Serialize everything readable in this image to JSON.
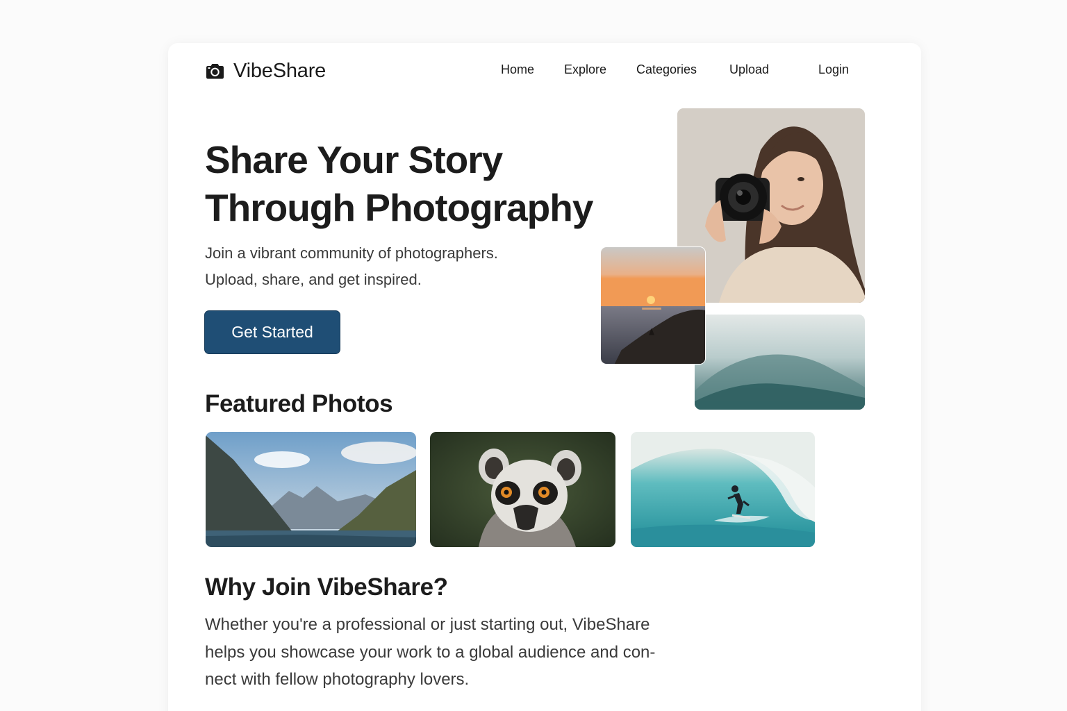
{
  "brand": {
    "name": "VibeShare",
    "icon": "camera-icon"
  },
  "nav": {
    "home": "Home",
    "explore": "Explore",
    "categories": "Categories",
    "upload": "Upload",
    "login": "Login"
  },
  "hero": {
    "title_line1": "Share Your Story",
    "title_line2": "Through Photography",
    "subtitle_line1": "Join a vibrant community of photographers.",
    "subtitle_line2": "Upload, share, and get inspired.",
    "cta_label": "Get Started"
  },
  "featured": {
    "heading": "Featured Photos"
  },
  "why": {
    "heading": "Why Join VibeShare?",
    "line1": "Whether you're a professional or just starting out, VibeShare",
    "line2": "helps you showcase your work to a global audience and con-",
    "line3": "nect with fellow photography lovers."
  },
  "colors": {
    "accent": "#1f4e75",
    "text": "#1c1c1c",
    "muted": "#3a3a3a"
  }
}
